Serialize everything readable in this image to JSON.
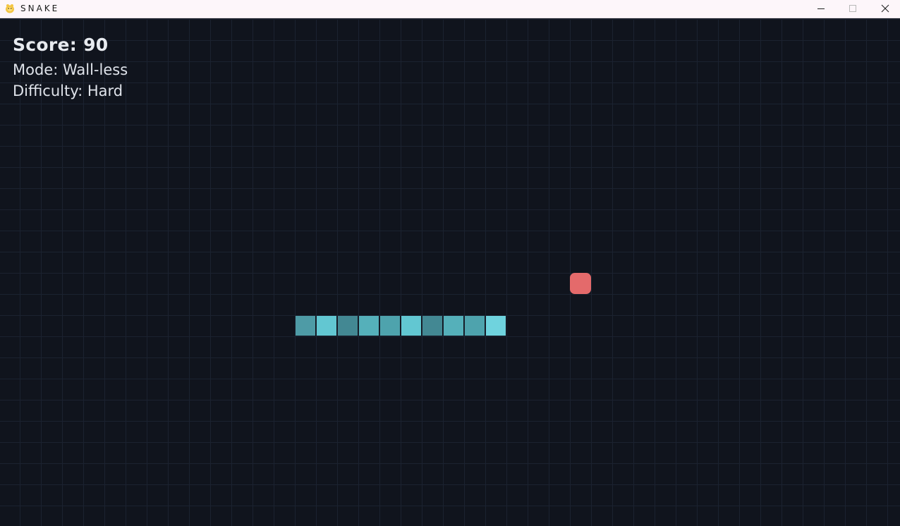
{
  "window": {
    "title": "SNAKE",
    "controls": {
      "minimize_icon": "minimize-icon",
      "maximize_icon": "maximize-icon",
      "close_icon": "close-icon"
    }
  },
  "hud": {
    "score": "Score: 90",
    "mode": "Mode: Wall-less",
    "difficulty": "Difficulty: Hard"
  },
  "colors": {
    "background": "#10141d",
    "grid": "#1b2230",
    "food": "#e46a6b",
    "snake_head": "#6fd3de",
    "snake_shades": [
      "#4e9ba6",
      "#62c7d2",
      "#438893",
      "#55b0ba",
      "#4ea3ad"
    ],
    "hud_text": "#e7eaef"
  },
  "board": {
    "cell_size": 30,
    "food": {
      "col": 26,
      "row": 12
    },
    "snake": [
      {
        "col": 22,
        "row": 14,
        "shade": "#6fd3de",
        "head": true
      },
      {
        "col": 21,
        "row": 14,
        "shade": "#4ea3ad"
      },
      {
        "col": 20,
        "row": 14,
        "shade": "#55b0ba"
      },
      {
        "col": 19,
        "row": 14,
        "shade": "#438893"
      },
      {
        "col": 18,
        "row": 14,
        "shade": "#62c7d2"
      },
      {
        "col": 17,
        "row": 14,
        "shade": "#4ea3ad"
      },
      {
        "col": 16,
        "row": 14,
        "shade": "#55b0ba"
      },
      {
        "col": 15,
        "row": 14,
        "shade": "#438893"
      },
      {
        "col": 14,
        "row": 14,
        "shade": "#62c7d2"
      },
      {
        "col": 13,
        "row": 14,
        "shade": "#4e9ba6"
      }
    ]
  }
}
